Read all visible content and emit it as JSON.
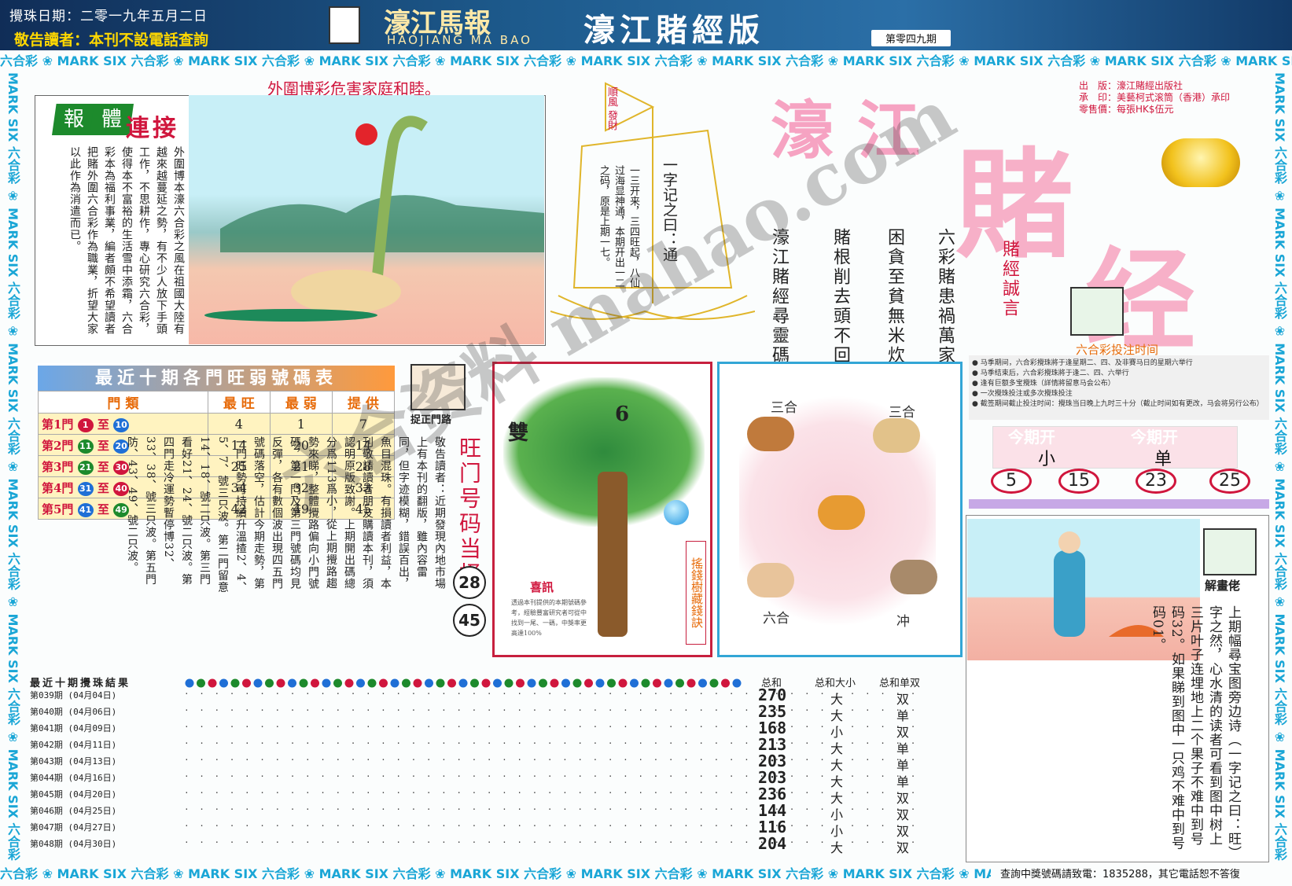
{
  "header": {
    "draw_date": "攪珠日期：二零一九年五月二日",
    "notice": "敬告讀者：本刊不設電話查詢",
    "logo_title": "濠江馬報",
    "logo_sub": "HAOJIANG MA BAO",
    "edition_title": "濠江賭經版",
    "issue": "第零四九期"
  },
  "strips": {
    "text": "六合彩 ❀ MARK SIX 六合彩 ❀ MARK SIX 六合彩 ❀ MARK SIX 六合彩 ❀ MARK SIX 六合彩 ❀ MARK SIX 六合彩 ❀ MARK SIX 六合彩 ❀ MARK SIX 六合彩 ❀ MARK SIX 六合彩 ❀ MARK SIX 六合彩 ❀ MARK SIX",
    "vertical": "MARK SIX 六合彩 ❀ MARK SIX 六合彩 ❀ MARK SIX 六合彩 ❀ MARK SIX 六合彩 ❀ MARK SIX 六合彩 ❀ MARK SIX 六合彩 ❀ MARK SIX 六合彩 ❀"
  },
  "headline": "外圍博彩危害家庭和睦。",
  "box1": {
    "title_1": "報",
    "title_2": "體",
    "title_3": "連接",
    "text": "外圍博本濠六合彩之風在祖國大陸有越來越蔓延之勢，有不少人放下手頭工作，不思耕作，專心研究六合彩，使得本不富裕的生活雪中添霜，六合彩本為福利事業，編者頗不希望讀者把賭外圍六合彩作為職業，折望大家以此作為消遣而已。"
  },
  "ship": {
    "flag": "順風 發財",
    "text_1": "一字记之曰：通",
    "text_2": "一三开来，三四旺起，八仙过海显神通，本期开出一二之码，原是上期一七。"
  },
  "main_logo": {
    "part_1": "濠江",
    "part_2": "賭",
    "part_3": "经"
  },
  "publisher": {
    "line_1": "出　版：濠江賭經出版社",
    "line_2": "承　印：美藝柯式滚筒（香港）承印",
    "line_3": "零售價：每張HK$伍元"
  },
  "mottos": {
    "label": "賭經誠言",
    "col_1": "六彩賭患禍萬家",
    "col_2": "困貪至貧無米炊",
    "col_3": "賭根削去頭不回",
    "col_4": "濠江賭經尋靈碼"
  },
  "hot_table": {
    "title": "最近十期各門旺弱號碼表",
    "headers": [
      "門 類",
      "最 旺",
      "最 弱",
      "提 供"
    ],
    "rows": [
      {
        "door": "第1門",
        "from": "1",
        "to": "10",
        "from_color": "#d0163d",
        "to_color": "#1f6fd6",
        "hot": "4",
        "cold": "1",
        "pick": "7"
      },
      {
        "door": "第2門",
        "from": "11",
        "to": "20",
        "from_color": "#1d8a2c",
        "to_color": "#1f6fd6",
        "hot": "14",
        "cold": "20",
        "pick": "14"
      },
      {
        "door": "第3門",
        "from": "21",
        "to": "30",
        "from_color": "#1d8a2c",
        "to_color": "#d0163d",
        "hot": "25",
        "cold": "21",
        "pick": "28"
      },
      {
        "door": "第4門",
        "from": "31",
        "to": "40",
        "from_color": "#1f6fd6",
        "to_color": "#d0163d",
        "hot": "34",
        "cold": "32",
        "pick": "33"
      },
      {
        "door": "第5門",
        "from": "41",
        "to": "49",
        "from_color": "#1f6fd6",
        "to_color": "#1d8a2c",
        "hot": "42",
        "cold": "49",
        "pick": "45"
      }
    ],
    "icon_label": "捉正門路",
    "vertical": "旺门号码当择",
    "num_1": "28",
    "num_2": "45"
  },
  "article": "敬告讀者：近期發現內地市場上有本刊的翻版，雖內容雷同，但字迹模糊，錯誤百出，魚目混珠。有損讀者利益，本刊敬請讀者朋友購讀本刊，須認明原版致謝。上期開出碼總分爲113爲小，從上期攪路趨勢來睇，整體攪路偏向小門號碼，第一門及第三門號碼均見反彈，各有數個波出現四五門號碼落空，估計今期走勢，第一門旺勢可持續升溫揸2、4、5、7、號三只波。第二門留意14、18、號二只波。第三門看好21、24、號二只波。第四門走冷運勢暫停博32、33、38、號三只波。第五門防、43、49、號二只波。",
  "tree": {
    "char_1": "雙",
    "char_2": "6",
    "news_title": "喜訊",
    "news_body": "透過本刊提供的本期號碼參考，經驗豐富研究者可從中找到一尾、一碼，中獎率更高達100%",
    "side": "搖錢樹藏錢訣"
  },
  "animals": {
    "label_1": "三合",
    "label_2": "三合",
    "label_3": "六合",
    "label_4": "冲"
  },
  "time_box": {
    "title": "六合彩投注时间",
    "items": [
      "● 马季期间，六合彩攪珠將于逢星期二、四、及非賽马日的星期六举行",
      "● 马季结束后，六合彩攪珠將于逢二、四、六举行",
      "● 逢有巨额多宝攪珠（詳情將留意马会公布）",
      "● 一次攪珠投注或多次攪珠投注",
      "● 截签期间截止投注时间：攪珠当日晚上九时三十分（截止时间如有更改，马会将另行公布）"
    ]
  },
  "this_period": {
    "head_1": "今期开",
    "val_1": "小",
    "head_2": "今期开",
    "val_2": "单",
    "nums": [
      "5",
      "15",
      "23",
      "25"
    ]
  },
  "picture": {
    "icon_label": "解畫佬",
    "text": "上期幅尋宝图旁边诗（一字记之曰：旺）字之然，心水清的读者可看到图中树上三片叶子连埋地上二个果子不难中到号码32。如果睇到图中一只鸡不难中到号码01。"
  },
  "draws": {
    "head": "最近十期攪珠結果",
    "sum_head": "总和",
    "size_head": "总和大小",
    "parity_head": "总和单双",
    "rows": [
      {
        "label": "第039期 (04月04日)",
        "sum": "270",
        "size": "大",
        "parity": "双"
      },
      {
        "label": "第040期 (04月06日)",
        "sum": "235",
        "size": "大",
        "parity": "单"
      },
      {
        "label": "第041期 (04月09日)",
        "sum": "168",
        "size": "小",
        "parity": "双"
      },
      {
        "label": "第042期 (04月11日)",
        "sum": "213",
        "size": "大",
        "parity": "单"
      },
      {
        "label": "第043期 (04月13日)",
        "sum": "203",
        "size": "大",
        "parity": "单"
      },
      {
        "label": "第044期 (04月16日)",
        "sum": "203",
        "size": "大",
        "parity": "单"
      },
      {
        "label": "第045期 (04月20日)",
        "sum": "236",
        "size": "大",
        "parity": "双"
      },
      {
        "label": "第046期 (04月25日)",
        "sum": "144",
        "size": "小",
        "parity": "双"
      },
      {
        "label": "第047期 (04月27日)",
        "sum": "116",
        "size": "小",
        "parity": "双"
      },
      {
        "label": "第048期 (04月30日)",
        "sum": "204",
        "size": "大",
        "parity": "双"
      }
    ]
  },
  "watermark": "六合资料 mahao.com",
  "footer_note": "查詢中獎號碼請致電：1835288，其它電話恕不答復"
}
